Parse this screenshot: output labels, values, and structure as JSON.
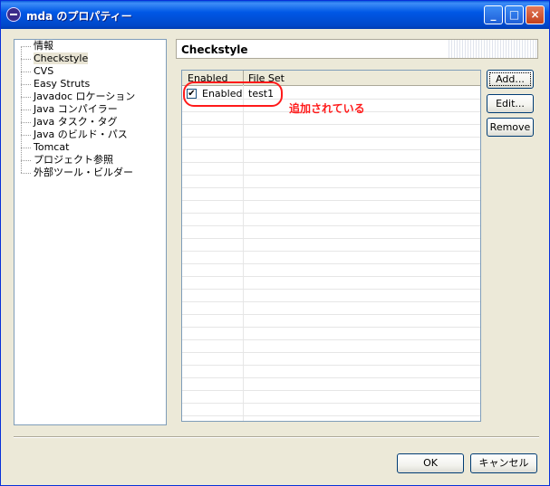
{
  "window": {
    "title": "mda のプロパティー",
    "controls": {
      "minimize": "_",
      "maximize": "□",
      "close": "×"
    }
  },
  "tree": {
    "items": [
      {
        "label": "情報",
        "selected": false
      },
      {
        "label": "Checkstyle",
        "selected": true
      },
      {
        "label": "CVS",
        "selected": false
      },
      {
        "label": "Easy Struts",
        "selected": false
      },
      {
        "label": "Javadoc ロケーション",
        "selected": false
      },
      {
        "label": "Java コンパイラー",
        "selected": false
      },
      {
        "label": "Java タスク・タグ",
        "selected": false
      },
      {
        "label": "Java のビルド・パス",
        "selected": false
      },
      {
        "label": "Tomcat",
        "selected": false
      },
      {
        "label": "プロジェクト参照",
        "selected": false
      },
      {
        "label": "外部ツール・ビルダー",
        "selected": false
      }
    ]
  },
  "panel": {
    "title": "Checkstyle",
    "table": {
      "columns": [
        "Enabled",
        "File Set"
      ],
      "rows": [
        {
          "enabled": true,
          "enabled_label": "Enabled",
          "file_set": "test1"
        }
      ],
      "checkbox_glyph": "✔"
    },
    "buttons": {
      "add": "Add...",
      "edit": "Edit...",
      "remove": "Remove"
    }
  },
  "annotation": {
    "text": "追加されている",
    "color": "#ff1a1a"
  },
  "footer": {
    "ok": "OK",
    "cancel": "キャンセル"
  }
}
